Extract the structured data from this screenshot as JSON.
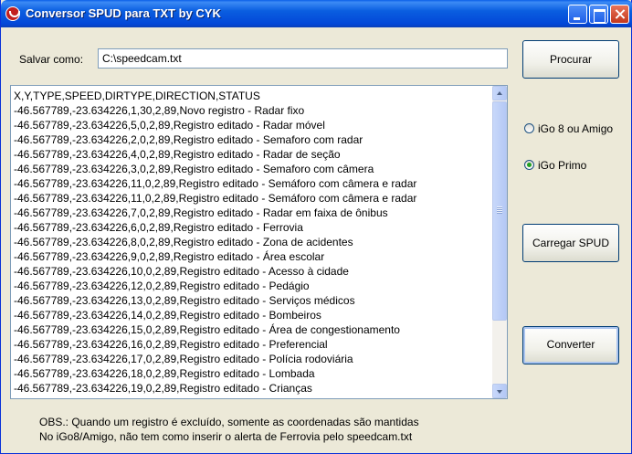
{
  "window": {
    "title": "Conversor SPUD para TXT by CYK"
  },
  "save": {
    "label": "Salvar como:",
    "value": "C:\\speedcam.txt"
  },
  "buttons": {
    "procurar": "Procurar",
    "carregar": "Carregar SPUD",
    "converter": "Converter"
  },
  "radios": [
    {
      "label": "iGo 8 ou Amigo",
      "selected": false
    },
    {
      "label": "iGo Primo",
      "selected": true
    }
  ],
  "output_lines": [
    "X,Y,TYPE,SPEED,DIRTYPE,DIRECTION,STATUS",
    "-46.567789,-23.634226,1,30,2,89,Novo registro - Radar fixo",
    "-46.567789,-23.634226,5,0,2,89,Registro editado - Radar móvel",
    "-46.567789,-23.634226,2,0,2,89,Registro editado - Semaforo com radar",
    "-46.567789,-23.634226,4,0,2,89,Registro editado - Radar de seção",
    "-46.567789,-23.634226,3,0,2,89,Registro editado - Semaforo com câmera",
    "-46.567789,-23.634226,11,0,2,89,Registro editado - Semáforo com câmera e radar",
    "-46.567789,-23.634226,11,0,2,89,Registro editado - Semáforo com câmera e radar",
    "-46.567789,-23.634226,7,0,2,89,Registro editado - Radar em faixa de ônibus",
    "-46.567789,-23.634226,6,0,2,89,Registro editado - Ferrovia",
    "-46.567789,-23.634226,8,0,2,89,Registro editado - Zona de acidentes",
    "-46.567789,-23.634226,9,0,2,89,Registro editado - Área escolar",
    "-46.567789,-23.634226,10,0,2,89,Registro editado - Acesso à cidade",
    "-46.567789,-23.634226,12,0,2,89,Registro editado - Pedágio",
    "-46.567789,-23.634226,13,0,2,89,Registro editado - Serviços médicos",
    "-46.567789,-23.634226,14,0,2,89,Registro editado - Bombeiros",
    "-46.567789,-23.634226,15,0,2,89,Registro editado - Área de congestionamento",
    "-46.567789,-23.634226,16,0,2,89,Registro editado - Preferencial",
    "-46.567789,-23.634226,17,0,2,89,Registro editado - Polícia rodoviária",
    "-46.567789,-23.634226,18,0,2,89,Registro editado - Lombada",
    "-46.567789,-23.634226,19,0,2,89,Registro editado - Crianças"
  ],
  "notes": [
    "OBS.: Quando um registro é excluído, somente as coordenadas são mantidas",
    "No iGo8/Amigo, não tem como inserir o alerta de Ferrovia pelo speedcam.txt"
  ],
  "icons": {
    "app": "app-icon",
    "minimize": "minimize-icon",
    "maximize": "maximize-icon",
    "close": "close-icon",
    "scroll_up": "arrow-up-icon",
    "scroll_down": "arrow-down-icon"
  }
}
